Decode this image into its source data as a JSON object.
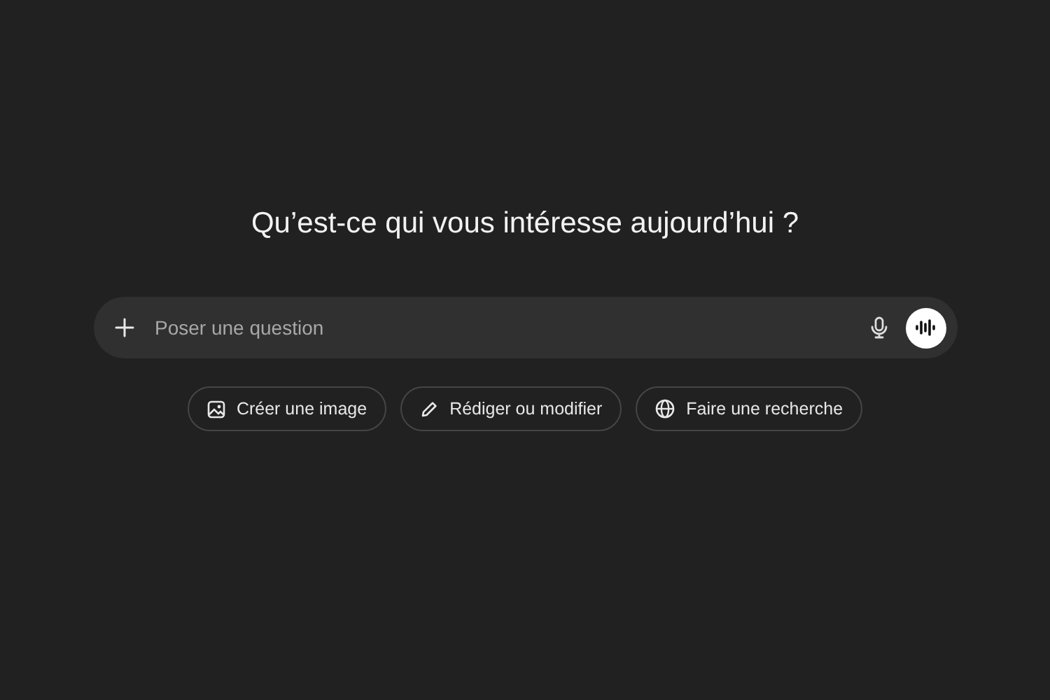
{
  "heading": "Qu’est-ce qui vous intéresse aujourd’hui ?",
  "composer": {
    "placeholder": "Poser une question"
  },
  "suggestions": [
    {
      "label": "Créer une image",
      "kind": "image"
    },
    {
      "label": "Rédiger ou modifier",
      "kind": "pencil"
    },
    {
      "label": "Faire une recherche",
      "kind": "globe"
    }
  ]
}
